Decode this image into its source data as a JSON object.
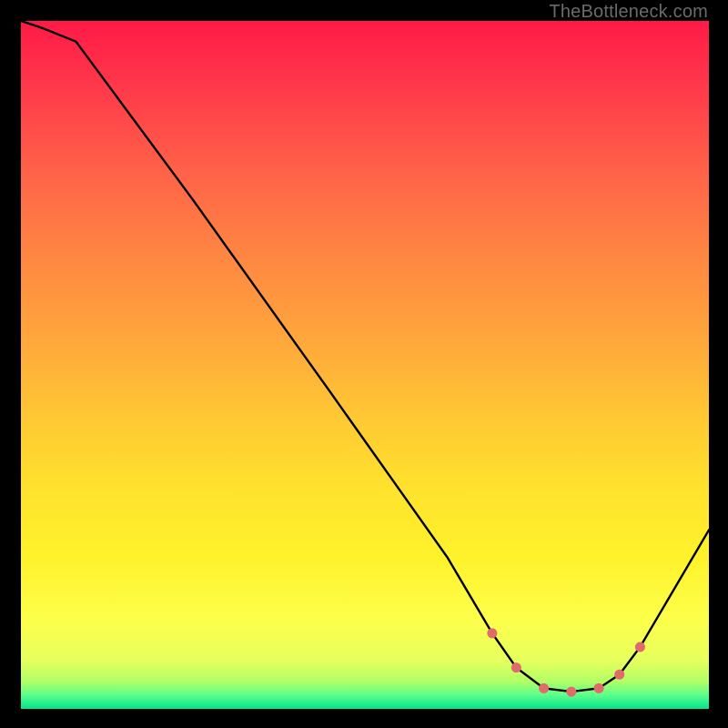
{
  "watermark": "TheBottleneck.com",
  "chart_data": {
    "type": "line",
    "title": "",
    "xlabel": "",
    "ylabel": "",
    "xlim": [
      0,
      100
    ],
    "ylim": [
      0,
      100
    ],
    "series": [
      {
        "name": "bottleneck-curve",
        "x": [
          0,
          3,
          8,
          25,
          45,
          62,
          68.5,
          72,
          76,
          80,
          84,
          87,
          90,
          100
        ],
        "y": [
          100,
          99,
          97,
          74,
          46,
          22,
          11,
          6,
          3,
          2.5,
          3,
          5,
          9,
          26
        ],
        "marker": [
          false,
          false,
          false,
          false,
          false,
          false,
          true,
          true,
          true,
          true,
          true,
          true,
          true,
          false
        ]
      }
    ],
    "marker_color": "#e16a6a",
    "line_color": "#000000",
    "gradient_stops": [
      {
        "pos": 0,
        "color": "#ff1a47"
      },
      {
        "pos": 50,
        "color": "#ffa63c"
      },
      {
        "pos": 80,
        "color": "#fff22c"
      },
      {
        "pos": 100,
        "color": "#00e58e"
      }
    ]
  }
}
